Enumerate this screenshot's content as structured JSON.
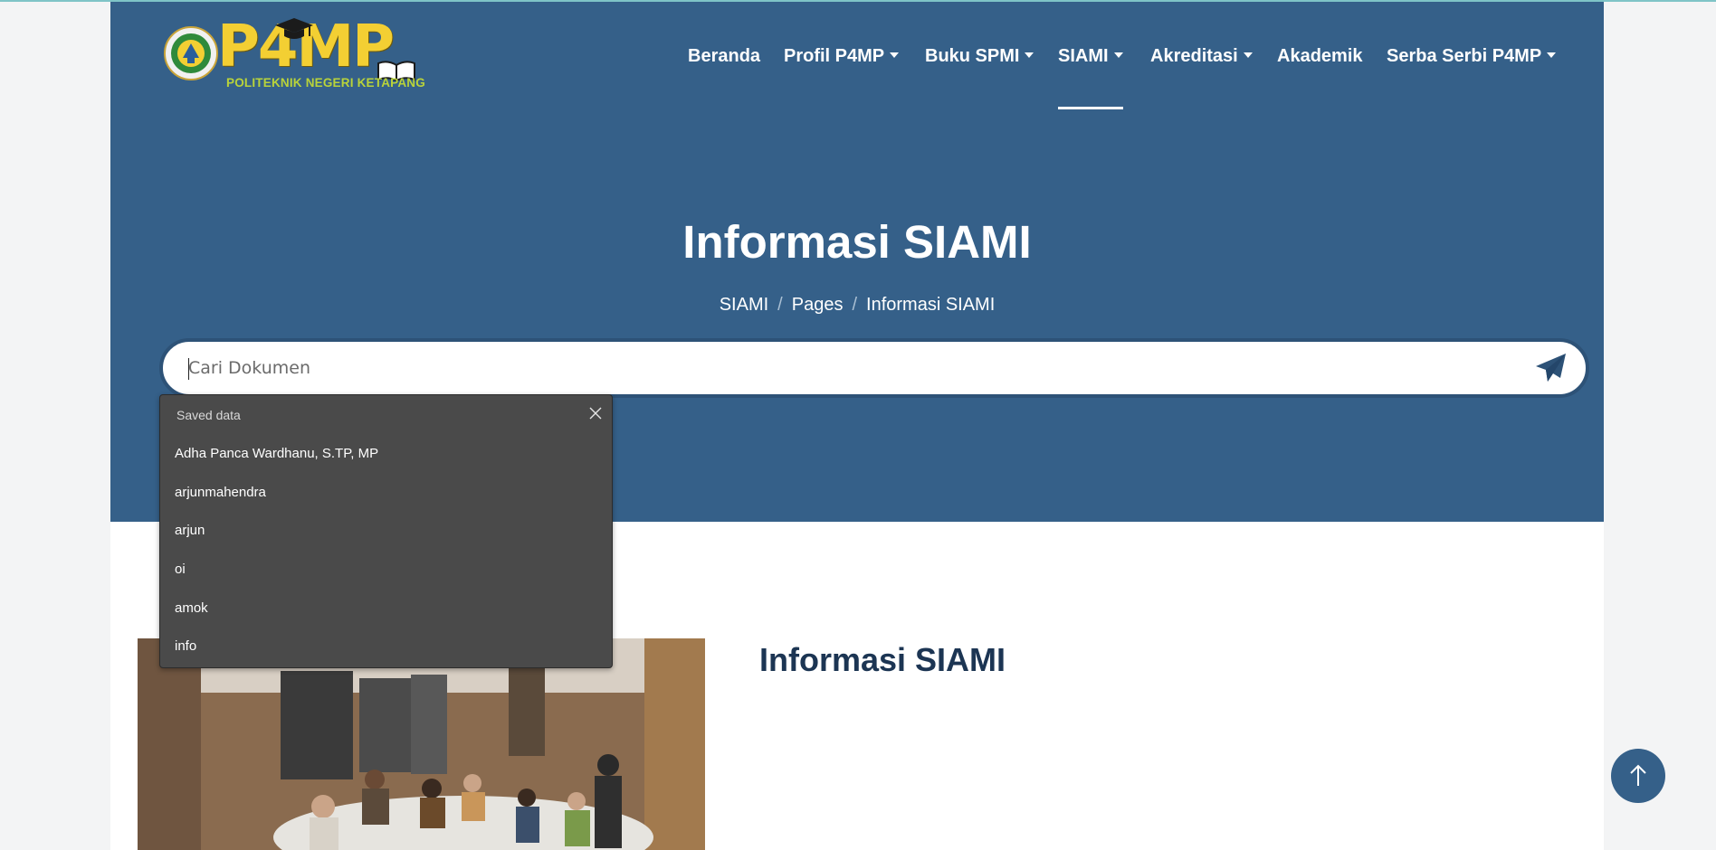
{
  "logo": {
    "title": "P4MP",
    "subtitle": "POLITEKNIK NEGERI KETAPANG"
  },
  "nav": {
    "items": [
      {
        "label": "Beranda",
        "dropdown": false
      },
      {
        "label": "Profil P4MP",
        "dropdown": true
      },
      {
        "label": "Buku SPMI",
        "dropdown": true
      },
      {
        "label": "SIAMI",
        "dropdown": true,
        "active": true
      },
      {
        "label": "Akreditasi",
        "dropdown": true
      },
      {
        "label": "Akademik",
        "dropdown": false
      },
      {
        "label": "Serba Serbi P4MP",
        "dropdown": true
      }
    ]
  },
  "hero": {
    "title": "Informasi SIAMI",
    "breadcrumb": [
      "SIAMI",
      "Pages",
      "Informasi SIAMI"
    ]
  },
  "search": {
    "placeholder": "Cari Dokumen",
    "value": ""
  },
  "autofill": {
    "header": "Saved data",
    "items": [
      "Adha Panca Wardhanu, S.TP, MP",
      "arjunmahendra",
      "arjun",
      "oi",
      "amok",
      "info"
    ]
  },
  "content": {
    "title": "Informasi SIAMI"
  },
  "colors": {
    "hero_bg": "#356089",
    "accent_yellow": "#f3cf33",
    "title_dark": "#1c3553",
    "popup_bg": "#4a4a4a"
  },
  "icons": {
    "send": "paper-plane-icon",
    "close": "close-icon",
    "back_to_top": "arrow-up-icon"
  }
}
